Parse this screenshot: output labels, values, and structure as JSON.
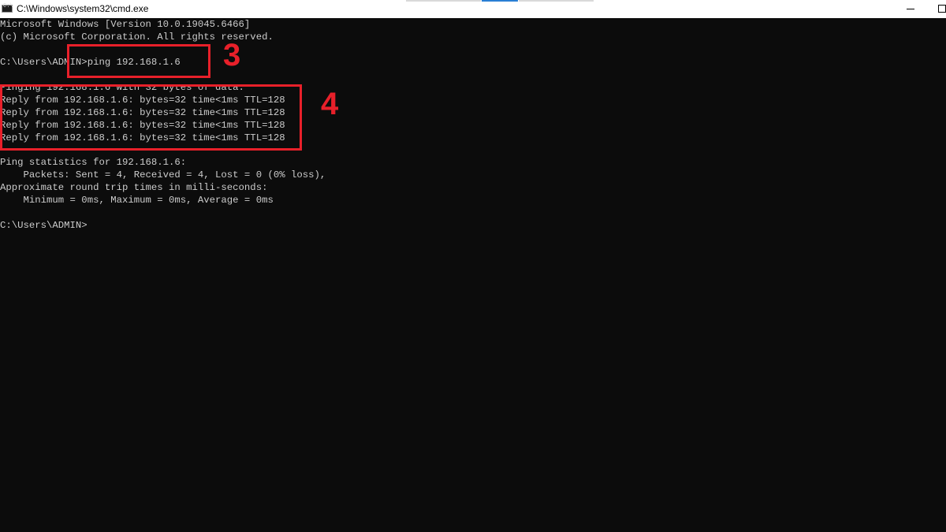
{
  "titlebar": {
    "icon": "cmd-icon",
    "icon_glyph": "C:\\",
    "title": "C:\\Windows\\system32\\cmd.exe"
  },
  "console": {
    "lines": [
      "Microsoft Windows [Version 10.0.19045.6466]",
      "(c) Microsoft Corporation. All rights reserved.",
      "",
      "C:\\Users\\ADMIN>ping 192.168.1.6",
      "",
      "Pinging 192.168.1.6 with 32 bytes of data:",
      "Reply from 192.168.1.6: bytes=32 time<1ms TTL=128",
      "Reply from 192.168.1.6: bytes=32 time<1ms TTL=128",
      "Reply from 192.168.1.6: bytes=32 time<1ms TTL=128",
      "Reply from 192.168.1.6: bytes=32 time<1ms TTL=128",
      "",
      "Ping statistics for 192.168.1.6:",
      "    Packets: Sent = 4, Received = 4, Lost = 0 (0% loss),",
      "Approximate round trip times in milli-seconds:",
      "    Minimum = 0ms, Maximum = 0ms, Average = 0ms",
      "",
      "C:\\Users\\ADMIN>"
    ]
  },
  "annotations": {
    "step3": "3",
    "step4": "4",
    "color": "#e8202a"
  },
  "colors": {
    "console_background": "#0c0c0c",
    "console_text": "#cccccc",
    "titlebar_background": "#ffffff"
  }
}
